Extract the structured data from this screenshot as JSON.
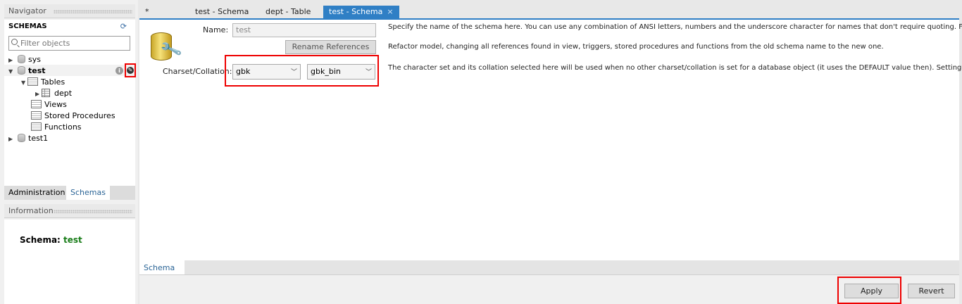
{
  "navigator": {
    "title": "Navigator",
    "schemas_header": "SCHEMAS",
    "filter_placeholder": "Filter objects",
    "tree": {
      "sys": "sys",
      "test": "test",
      "tables": "Tables",
      "dept": "dept",
      "views": "Views",
      "stored_procedures": "Stored Procedures",
      "functions": "Functions",
      "test1": "test1"
    },
    "tabs": [
      "Administration",
      "Schemas"
    ],
    "active_tab": "Schemas"
  },
  "information": {
    "title": "Information",
    "schema_label": "Schema:",
    "schema_value": "test"
  },
  "doc_tabs": [
    {
      "label": "*"
    },
    {
      "label": "test - Schema"
    },
    {
      "label": "dept - Table"
    },
    {
      "label": "test - Schema",
      "active": true,
      "close": "×"
    }
  ],
  "editor": {
    "name_label": "Name:",
    "name_value": "test",
    "rename_button": "Rename References",
    "charset_label": "Charset/Collation:",
    "charset_value": "gbk",
    "collation_value": "gbk_bin",
    "help_name": "Specify the name of the schema here. You can use any combination of ANSI letters, numbers and the underscore character for names that don't require quoting. For",
    "help_rename": "Refactor model, changing all references found in view, triggers, stored procedures and functions from the old schema name to the new one.",
    "help_charset": "The character set and its collation selected here will be used when no other charset/collation is set for a database object (it uses the DEFAULT value then). Setting"
  },
  "bottom_tab": "Schema",
  "footer": {
    "apply": "Apply",
    "revert": "Revert"
  },
  "colors": {
    "accent": "#2f7fc5",
    "highlight_box": "#e00000",
    "schema_value": "#1a7d1a"
  }
}
